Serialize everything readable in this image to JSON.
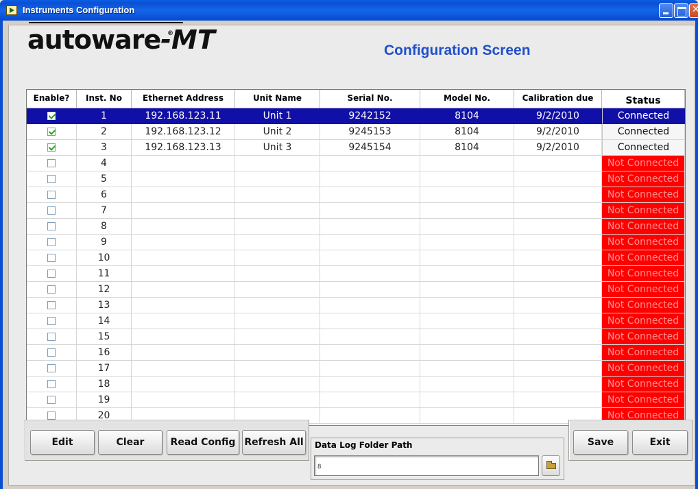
{
  "window": {
    "title": "Instruments Configuration"
  },
  "logo": {
    "brand": "autoware",
    "suffix": "-MT",
    "registered": "®"
  },
  "screen_title": "Configuration Screen",
  "table": {
    "columns": [
      {
        "key": "enable",
        "label": "Enable?"
      },
      {
        "key": "inst_no",
        "label": "Inst. No"
      },
      {
        "key": "ethernet",
        "label": "Ethernet Address"
      },
      {
        "key": "unit",
        "label": "Unit Name"
      },
      {
        "key": "serial",
        "label": "Serial No."
      },
      {
        "key": "model",
        "label": "Model No."
      },
      {
        "key": "calibration",
        "label": "Calibration due"
      },
      {
        "key": "status",
        "label": "Status"
      }
    ],
    "selected_row": 1,
    "rows": [
      {
        "enabled": true,
        "inst_no": "1",
        "ethernet": "192.168.123.11",
        "unit": "Unit 1",
        "serial": "9242152",
        "model": "8104",
        "calibration": "9/2/2010",
        "status": "Connected"
      },
      {
        "enabled": true,
        "inst_no": "2",
        "ethernet": "192.168.123.12",
        "unit": "Unit 2",
        "serial": "9245153",
        "model": "8104",
        "calibration": "9/2/2010",
        "status": "Connected"
      },
      {
        "enabled": true,
        "inst_no": "3",
        "ethernet": "192.168.123.13",
        "unit": "Unit 3",
        "serial": "9245154",
        "model": "8104",
        "calibration": "9/2/2010",
        "status": "Connected"
      },
      {
        "enabled": false,
        "inst_no": "4",
        "ethernet": "",
        "unit": "",
        "serial": "",
        "model": "",
        "calibration": "",
        "status": "Not Connected"
      },
      {
        "enabled": false,
        "inst_no": "5",
        "ethernet": "",
        "unit": "",
        "serial": "",
        "model": "",
        "calibration": "",
        "status": "Not Connected"
      },
      {
        "enabled": false,
        "inst_no": "6",
        "ethernet": "",
        "unit": "",
        "serial": "",
        "model": "",
        "calibration": "",
        "status": "Not Connected"
      },
      {
        "enabled": false,
        "inst_no": "7",
        "ethernet": "",
        "unit": "",
        "serial": "",
        "model": "",
        "calibration": "",
        "status": "Not Connected"
      },
      {
        "enabled": false,
        "inst_no": "8",
        "ethernet": "",
        "unit": "",
        "serial": "",
        "model": "",
        "calibration": "",
        "status": "Not Connected"
      },
      {
        "enabled": false,
        "inst_no": "9",
        "ethernet": "",
        "unit": "",
        "serial": "",
        "model": "",
        "calibration": "",
        "status": "Not Connected"
      },
      {
        "enabled": false,
        "inst_no": "10",
        "ethernet": "",
        "unit": "",
        "serial": "",
        "model": "",
        "calibration": "",
        "status": "Not Connected"
      },
      {
        "enabled": false,
        "inst_no": "11",
        "ethernet": "",
        "unit": "",
        "serial": "",
        "model": "",
        "calibration": "",
        "status": "Not Connected"
      },
      {
        "enabled": false,
        "inst_no": "12",
        "ethernet": "",
        "unit": "",
        "serial": "",
        "model": "",
        "calibration": "",
        "status": "Not Connected"
      },
      {
        "enabled": false,
        "inst_no": "13",
        "ethernet": "",
        "unit": "",
        "serial": "",
        "model": "",
        "calibration": "",
        "status": "Not Connected"
      },
      {
        "enabled": false,
        "inst_no": "14",
        "ethernet": "",
        "unit": "",
        "serial": "",
        "model": "",
        "calibration": "",
        "status": "Not Connected"
      },
      {
        "enabled": false,
        "inst_no": "15",
        "ethernet": "",
        "unit": "",
        "serial": "",
        "model": "",
        "calibration": "",
        "status": "Not Connected"
      },
      {
        "enabled": false,
        "inst_no": "16",
        "ethernet": "",
        "unit": "",
        "serial": "",
        "model": "",
        "calibration": "",
        "status": "Not Connected"
      },
      {
        "enabled": false,
        "inst_no": "17",
        "ethernet": "",
        "unit": "",
        "serial": "",
        "model": "",
        "calibration": "",
        "status": "Not Connected"
      },
      {
        "enabled": false,
        "inst_no": "18",
        "ethernet": "",
        "unit": "",
        "serial": "",
        "model": "",
        "calibration": "",
        "status": "Not Connected"
      },
      {
        "enabled": false,
        "inst_no": "19",
        "ethernet": "",
        "unit": "",
        "serial": "",
        "model": "",
        "calibration": "",
        "status": "Not Connected"
      },
      {
        "enabled": false,
        "inst_no": "20",
        "ethernet": "",
        "unit": "",
        "serial": "",
        "model": "",
        "calibration": "",
        "status": "Not Connected"
      }
    ]
  },
  "buttons": {
    "edit": "Edit",
    "clear": "Clear",
    "read_config": "Read Config",
    "refresh_all": "Refresh All",
    "save": "Save",
    "exit": "Exit"
  },
  "data_log": {
    "label": "Data Log Folder Path",
    "value": "",
    "prefix_glyph": "8"
  },
  "colors": {
    "selected_row": "#1010a8",
    "status_bad": "#ff0000",
    "title_blue": "#1f4fc8",
    "checkmark": "#21a121"
  }
}
